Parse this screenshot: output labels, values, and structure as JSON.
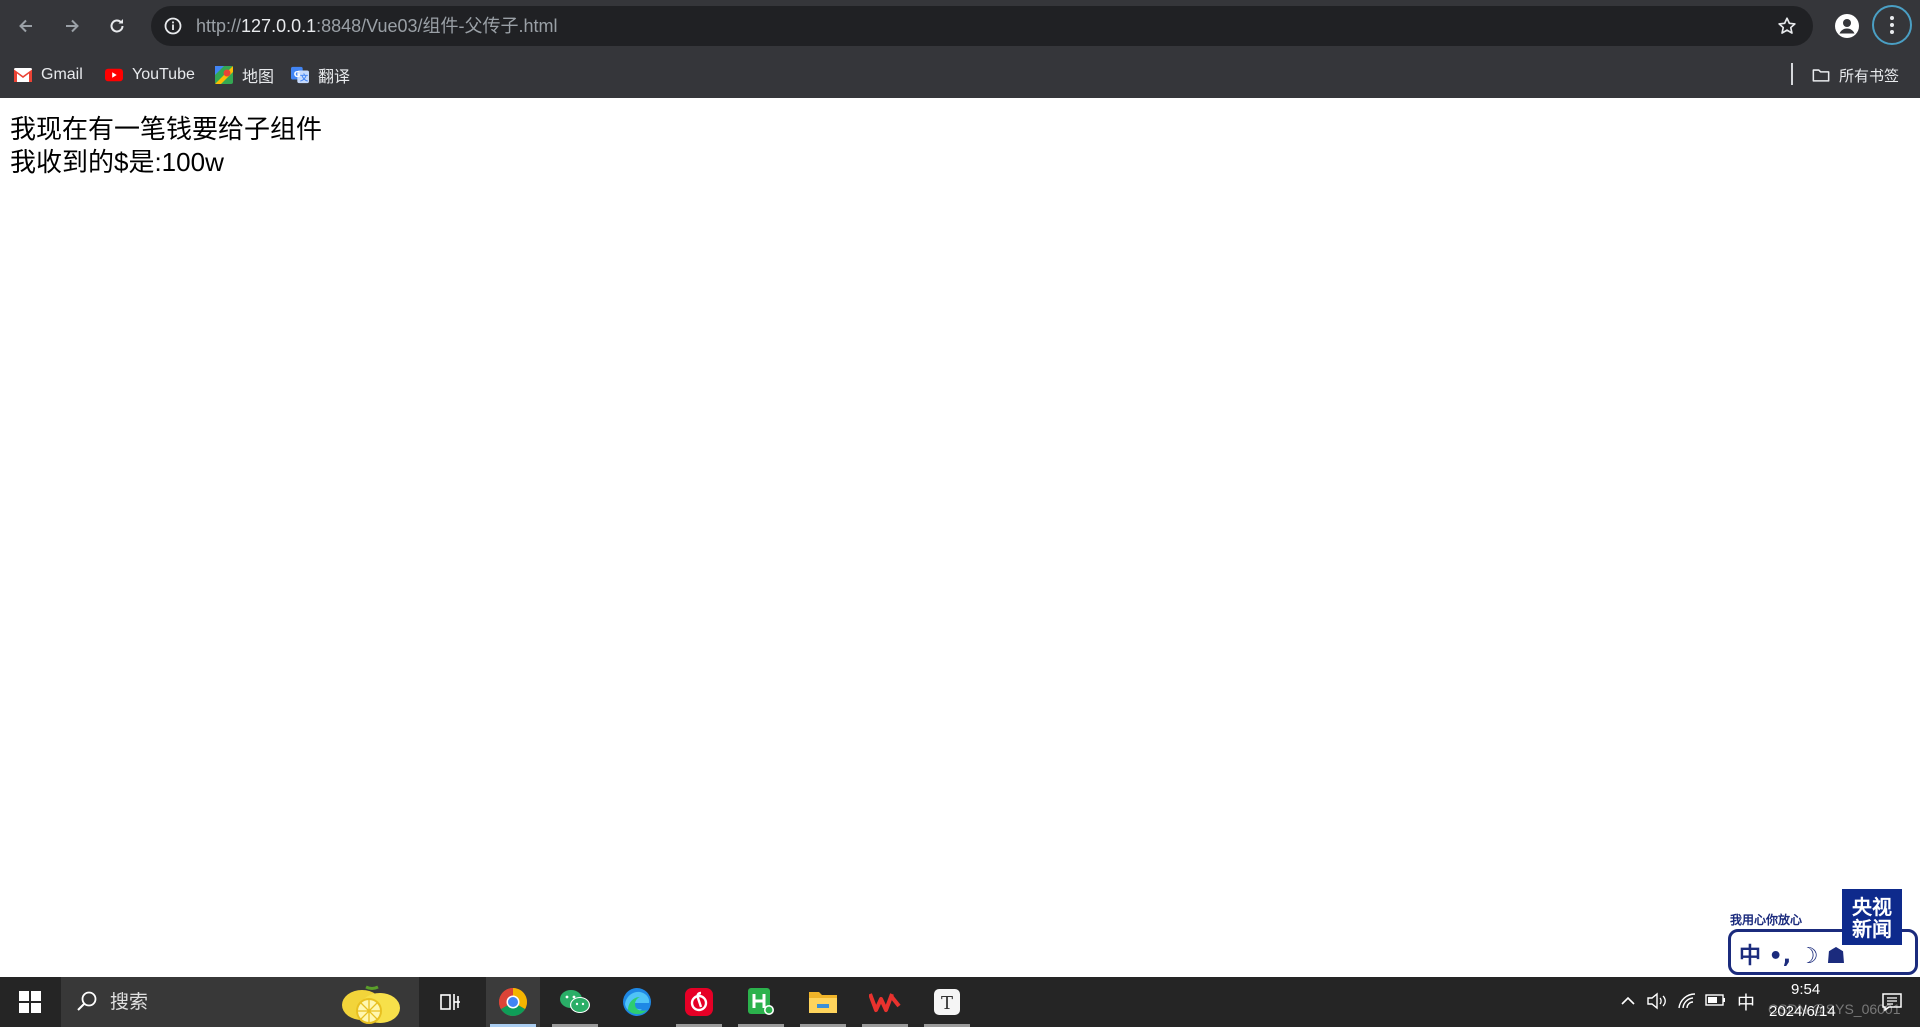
{
  "browser": {
    "url_scheme": "http://",
    "url_host": "127.0.0.1",
    "url_rest": ":8848/Vue03/组件-父传子.html",
    "bookmarks": [
      {
        "label": "Gmail",
        "icon": "gmail-icon"
      },
      {
        "label": "YouTube",
        "icon": "youtube-icon"
      },
      {
        "label": "地图",
        "icon": "maps-icon"
      },
      {
        "label": "翻译",
        "icon": "translate-icon"
      }
    ],
    "all_bookmarks_label": "所有书签"
  },
  "page": {
    "line1": "我现在有一笔钱要给子组件",
    "line2": "我收到的$是:100w"
  },
  "news_widget": {
    "slogan": "我用心你放心",
    "bar_text": "中 •, ☽ ☗",
    "logo_line1": "央视",
    "logo_line2": "新闻"
  },
  "taskbar": {
    "search_placeholder": "搜索",
    "apps": [
      "task-view",
      "chrome",
      "wechat",
      "edge",
      "netease-music",
      "hbuilderx",
      "file-explorer",
      "wps",
      "typora"
    ],
    "active_app": "chrome",
    "ime_label": "中",
    "time": "9:54",
    "date": "2024/6/14",
    "watermark": "CSDN @SYS_06001"
  },
  "colors": {
    "chrome_toolbar": "#35363a",
    "omnibox": "#202124",
    "taskbar": "#252525",
    "cctv_blue": "#1b2b7d"
  }
}
